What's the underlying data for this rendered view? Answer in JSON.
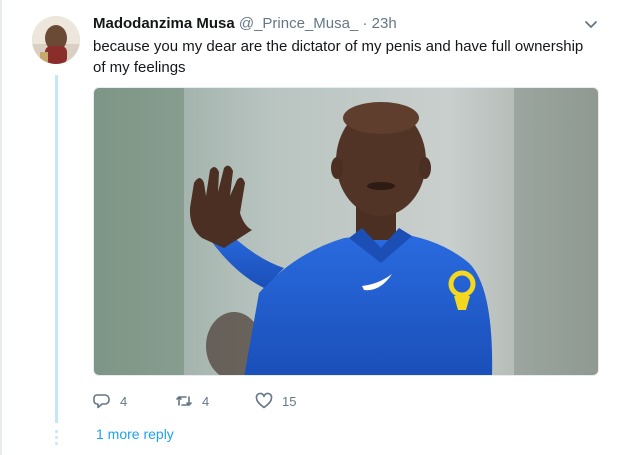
{
  "tweet": {
    "display_name": "Madodanzima Musa",
    "handle": "@_Prince_Musa_",
    "separator": "·",
    "timestamp": "23h",
    "text": "because you my dear are the dictator of my penis and have full ownership of my feelings"
  },
  "actions": {
    "reply_count": "4",
    "retweet_count": "4",
    "like_count": "15"
  },
  "thread": {
    "more_replies_label": "1 more reply"
  },
  "colors": {
    "accent": "#1da1f2",
    "muted": "#657786",
    "thread_line": "#c4e6f6",
    "kit_blue": "#1f5fd6",
    "kit_yellow": "#f4d81f"
  },
  "icons": [
    "caret-down-icon",
    "reply-icon",
    "retweet-icon",
    "like-icon"
  ]
}
